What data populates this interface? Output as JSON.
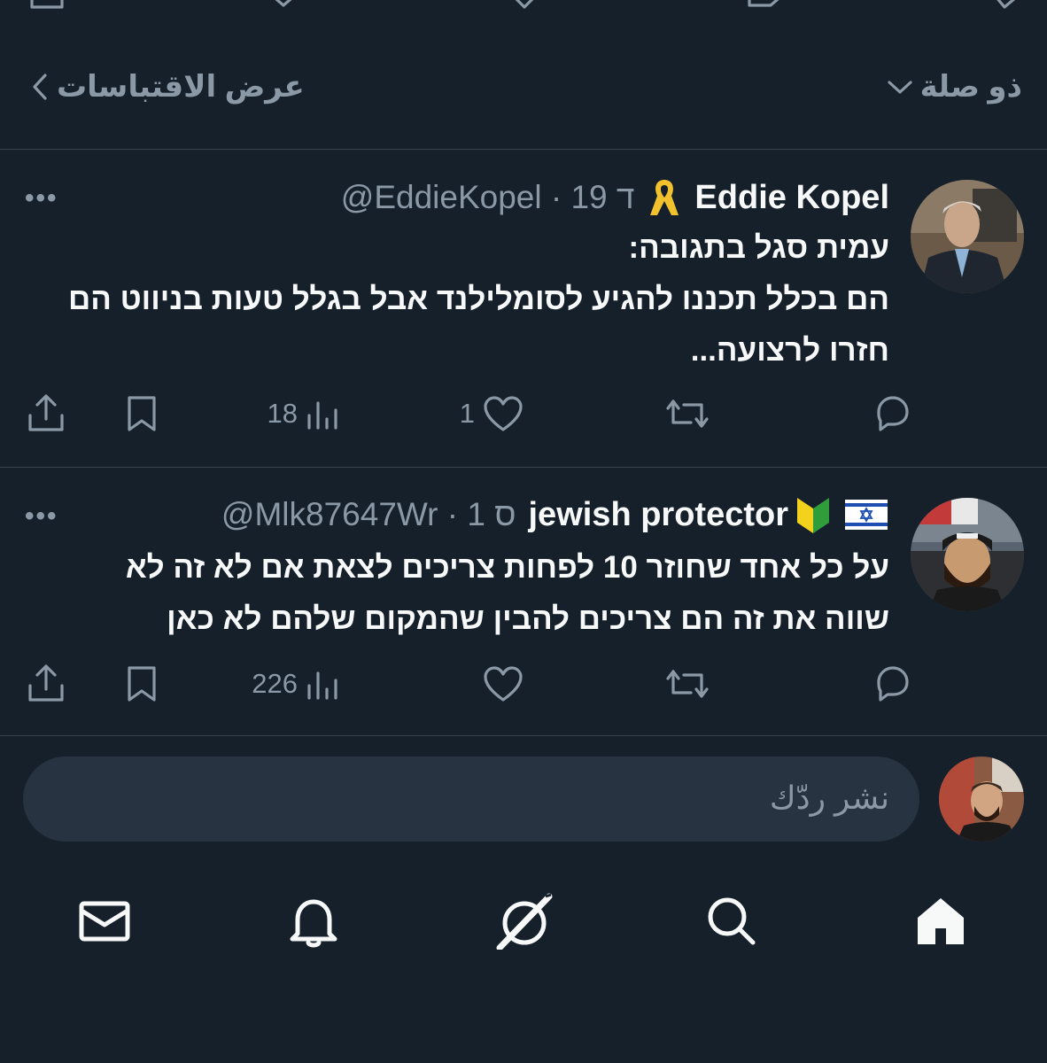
{
  "filter": {
    "sort_label": "ذو صلة",
    "quotes_label": "عرض الاقتباسات"
  },
  "tweets": [
    {
      "display_name": "Eddie Kopel",
      "badge_icon": "yellow-ribbon-icon",
      "handle_meta": "@EddieKopel · 19 ד",
      "more": "•••",
      "lines": [
        "עמית סגל בתגובה:",
        "הם בכלל תכננו להגיע לסומלילנד אבל בגלל טעות בניווט הם",
        "חזרו לרצועה..."
      ],
      "actions": {
        "reply_count": "",
        "retweet_count": "",
        "like_count": "1",
        "views_count": "18"
      }
    },
    {
      "display_name": "jewish protector",
      "badge_icon": "beginner-symbol-icon",
      "flag_icon": "israel-flag-icon",
      "handle_meta": "@Mlk87647Wr · 1 ס",
      "more": "•••",
      "lines": [
        "על כל אחד שחוזר 10 לפחות צריכים לצאת אם לא זה לא",
        "שווה את זה הם צריכים להבין שהמקום שלהם לא כאן"
      ],
      "actions": {
        "reply_count": "",
        "retweet_count": "",
        "like_count": "",
        "views_count": "226"
      }
    }
  ],
  "composer": {
    "placeholder": "نشر ردّك"
  },
  "nav": [
    "home-icon",
    "search-icon",
    "grok-icon",
    "notifications-icon",
    "messages-icon"
  ],
  "colors": {
    "background": "#15202b",
    "muted": "#8b98a5",
    "text": "#f7f9f9",
    "divider": "#38444d"
  }
}
